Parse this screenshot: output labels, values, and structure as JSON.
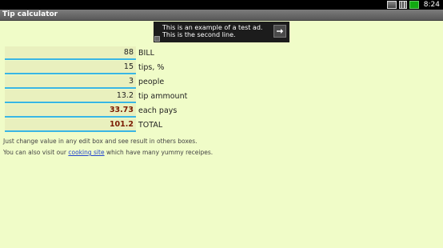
{
  "status_bar": {
    "time": "8:24"
  },
  "app": {
    "title": "Tip calculator"
  },
  "ad": {
    "text": "This is an example of a test ad. This is the second line."
  },
  "rows": [
    {
      "value": "88",
      "label": "BILL"
    },
    {
      "value": "15",
      "label": "tips, %"
    },
    {
      "value": "3",
      "label": "people"
    },
    {
      "value": "13.2",
      "label": "tip ammount"
    },
    {
      "value": "33.73",
      "label": "each pays"
    },
    {
      "value": "101.2",
      "label": "TOTAL"
    }
  ],
  "notes": {
    "line1": "Just change value in any edit box and see result in others boxes.",
    "line2_prefix": "You can also visit our ",
    "line2_link": "cooking site",
    "line2_suffix": " which have many yummy receipes."
  },
  "colors": {
    "background": "#f0fcc8",
    "field_bg": "#e9f0be",
    "field_underline": "#39b6e4",
    "result_text": "#7a1a00",
    "link": "#2244cc"
  }
}
